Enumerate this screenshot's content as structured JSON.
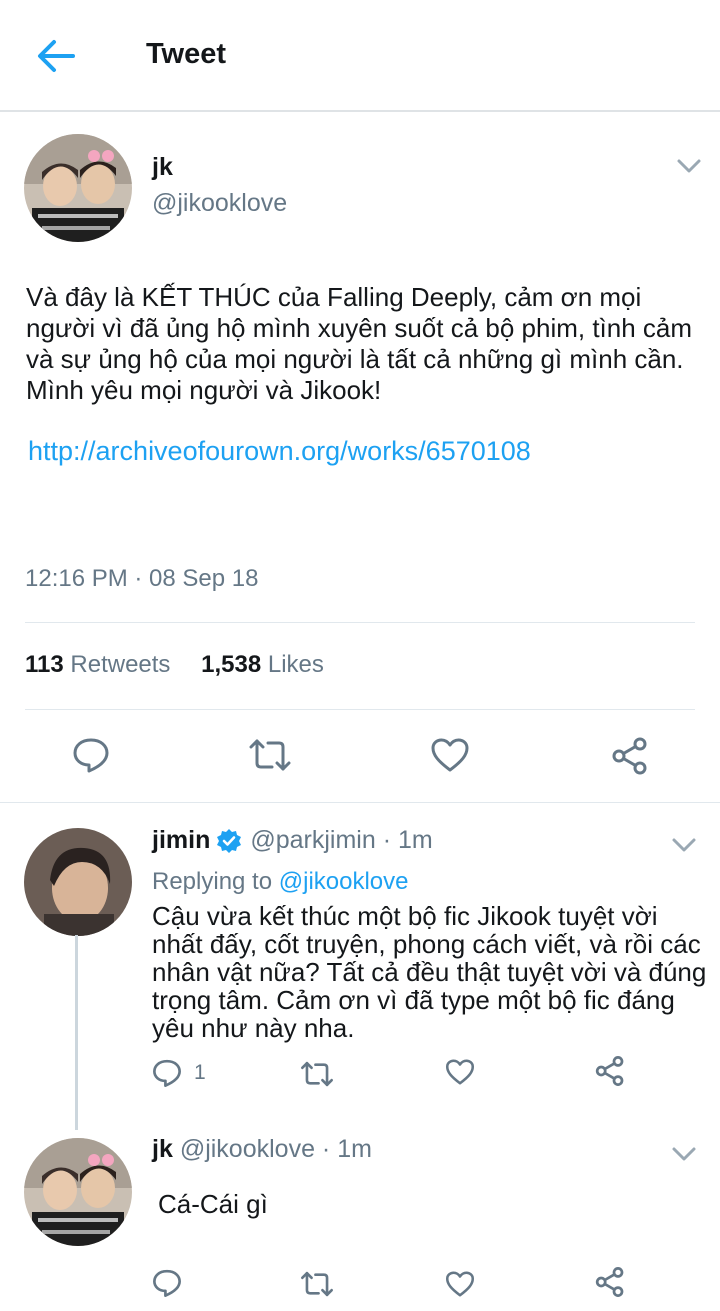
{
  "header": {
    "title": "Tweet"
  },
  "tweet": {
    "name": "jk",
    "handle": "@jikooklove",
    "text": "Và đây là KẾT THÚC của Falling Deeply, cảm ơn mọi người vì đã ủng hộ mình xuyên suốt cả bộ phim, tình cảm và sự ủng hộ của mọi người là tất cả những gì mình cần. Mình yêu mọi người và Jikook!",
    "link": "http://archiveofourown.org/works/6570108",
    "timestamp": "12:16 PM · 08 Sep 18",
    "retweets_count": "113",
    "retweets_label": "Retweets",
    "likes_count": "1,538",
    "likes_label": "Likes"
  },
  "replies": [
    {
      "name": "jimin",
      "handle": "@parkjimin",
      "time": "· 1m",
      "replying_to_label": "Replying to",
      "replying_to_handle": "@jikooklove",
      "text": "Cậu vừa kết thúc một bộ fic Jikook tuyệt vời nhất đấy, cốt truyện, phong cách viết, và rồi các nhân vật nữa? Tất cả đều thật tuyệt vời và đúng trọng tâm. Cảm ơn vì đã type một bộ fic đáng yêu như này nha.",
      "reply_count": "1"
    },
    {
      "name": "jk",
      "handle": "@jikooklove",
      "time": "· 1m",
      "text": "Cá-Cái gì"
    }
  ],
  "icons": {
    "back": "arrow-left-icon",
    "chevron": "chevron-down-icon",
    "reply": "speech-bubble-icon",
    "retweet": "retweet-icon",
    "like": "heart-icon",
    "share": "share-icon",
    "verified": "verified-badge-icon"
  },
  "colors": {
    "accent": "#1da1f2",
    "text": "#14171a",
    "muted": "#657786",
    "divider": "#e1e8ed"
  }
}
